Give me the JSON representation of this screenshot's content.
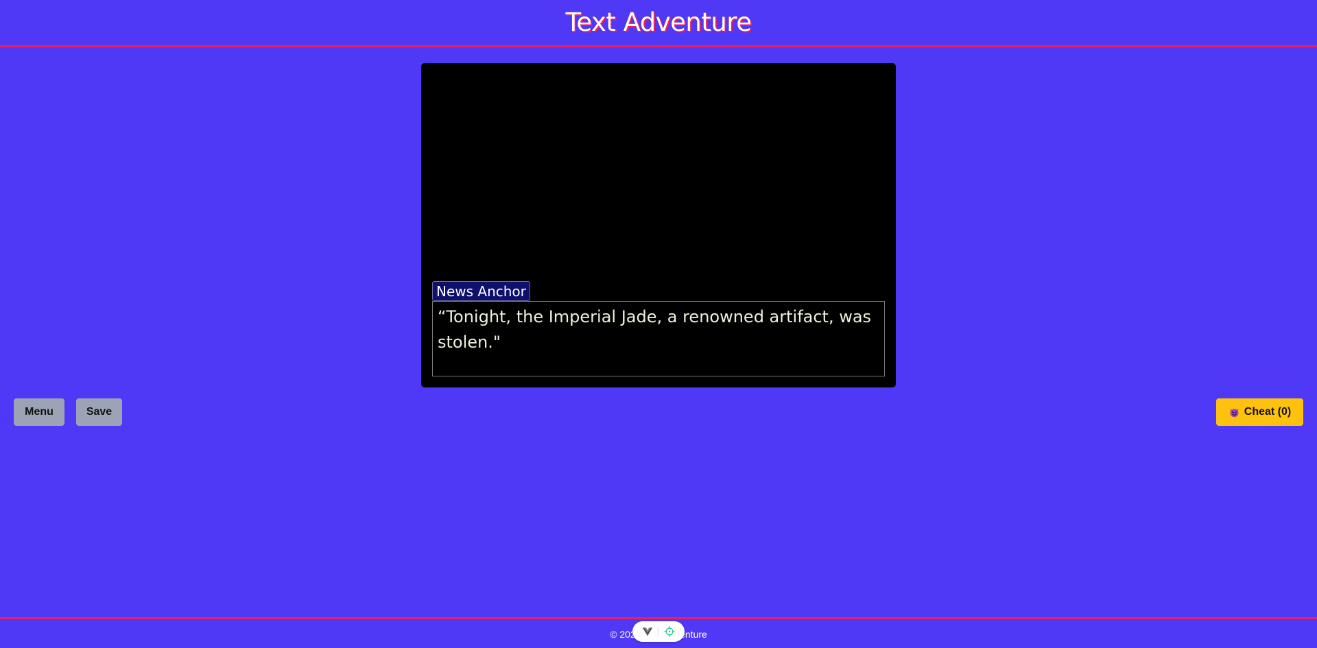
{
  "header": {
    "title": "Text Adventure"
  },
  "scene": {
    "speaker": "News Anchor",
    "dialogue": "“Tonight, the Imperial Jade, a renowned artifact, was stolen.\""
  },
  "controls": {
    "menu_label": "Menu",
    "save_label": "Save",
    "cheat_label": "Cheat (0)",
    "cheat_icon": "devil-face-icon"
  },
  "footer": {
    "text": "© 2025 Text Adventure"
  },
  "devtools": {
    "icons": [
      "vue-logo-icon",
      "crosshair-icon"
    ]
  },
  "colors": {
    "background": "#4f39f6",
    "accent": "#ec1e5e",
    "cheat": "#fec20e",
    "button": "#9ba3b4"
  }
}
